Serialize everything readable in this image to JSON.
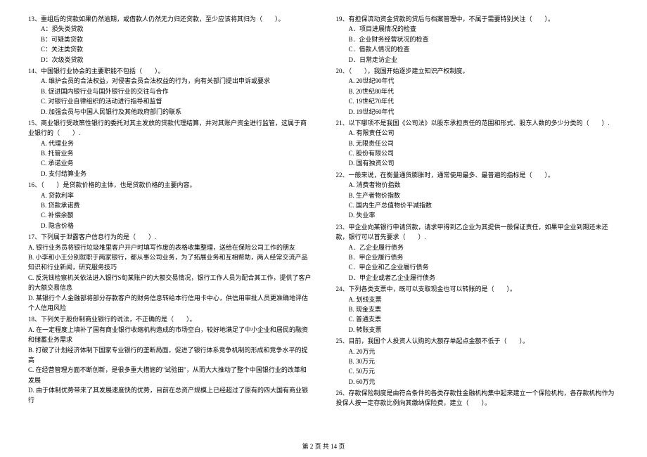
{
  "left": {
    "q13": {
      "text": "13、重组后的贷款如果仍然逾期，或借款人仍然无力归还贷款，至少应该将其归为（　　）。",
      "a": "A：损失类贷款",
      "b": "B：可疑类贷款",
      "c": "C：关注类贷款",
      "d": "D：次级类贷款"
    },
    "q14": {
      "text": "14、中国银行业协会的主要职能不包括（　　）。",
      "a": "A. 维护会员的合法权益，对侵害会员合法权益的行为，向有关部门提出申诉或要求",
      "b": "B. 促进国内银行业与国外银行业的交往与合作",
      "c": "C. 对银行业自律组织的活动进行指导和监督",
      "d": "D. 加强会员与中国人民银行及其他政府部门的联系"
    },
    "q15": {
      "text": "15、商业银行受政策性银行的委托对其主发放的贷款代理结算，并对其账户资金进行监管，这属于商业银行的（　　）.",
      "a": "A. 代理业务",
      "b": "B. 托管业务",
      "c": "C. 承诺业务",
      "d": "D. 支付结算业务"
    },
    "q16": {
      "text": "16、（　　）是贷款价格的主体，也是贷款价格的主要内容。",
      "a": "A. 贷款利率",
      "b": "B. 贷款承诺费",
      "c": "C. 补偿余额",
      "d": "D. 隐含价格"
    },
    "q17": {
      "text": "17、下列属于泄露客户信息行为的是（　　）.",
      "a": "A. 银行业务员将银行垃圾堆里客户开户时填写作废的表格收集整理，送给在保险公司工作的朋友",
      "b": "B. 小李和小王分别就职于两家银行，都从事公司业务，为了拓展业务和互相帮助，两人经常交流产品知识和行业新闻，研究服务技巧",
      "c": "C. 反洗钱检察机关依法进入银行S旬某账户的大额交易情况，银行工作人员为配合其工作，提供了客户的大额交易信息",
      "d": "D. 某银行个人金融部将部分存款客户的财务信息转给本行信用卡中心，供信用审批人员更准确地评估个人信用风险"
    },
    "q18": {
      "text": "18、下列关于股份制商业银行的说法，不正确的是（　　）。",
      "a": "A. 在一定程度上填补了国有商业银行收缩机构造成的市场空白，较好地满足了中小企业和居民的融资和储蓄业务需求",
      "b": "B. 打破了计划经济体制下国家专业银行的垄断局面，促进了银行体系竞争机制的形成和竞争水平的提高",
      "c": "C. 在经营管理方面不断创新，是很多重大措施的\"试验田\"，从而大大推动了整个中国银行业的改革和发展",
      "d": "D. 由于体制优势带来了其发展速度快的优势，目前在总资产规模上已经超过了原有的四大国有商业银行"
    }
  },
  "right": {
    "q19": {
      "text": "19、有担保流动资金贷款的贷后与档案管理中，不属于需要特别关注（　　）。",
      "a": "A．项目进展情况的检查",
      "b": "B．企业财务经营状况的检查",
      "c": "C．借款人情况的检查",
      "d": "D．日常走访企业"
    },
    "q20": {
      "text": "20、（　　），我国开始逐步建立知识产权制度。",
      "a": "A. 20世纪90年代",
      "b": "B. 20世纪80年代",
      "c": "C. 19世纪70年代",
      "d": "D. 19世纪60年代"
    },
    "q21": {
      "text": "21、以下哪项不是我国《公司法》以股东承担责任的范围和形式、股东人数的多少分类的（　　）.",
      "a": "A. 有限责任公司",
      "b": "B. 无限责任公司",
      "c": "C. 股份有限公司",
      "d": "D. 国有独资公司"
    },
    "q22": {
      "text": "22、一般来说，在衡量通货膨胀时，通常使用最多、最普遍的指标是（　　）。",
      "a": "A. 消费者物价指数",
      "b": "B. 生产者物价指数",
      "c": "C. 国内生产总值物价平减指数",
      "d": "D. 失业率"
    },
    "q23": {
      "text": "23、甲企业向某银行申请贷款，请求甲得到乙企业为其提供一般保证责任，如果甲企业到期还未还款，银行可以首先要求（　　）.",
      "a": "A．乙企业履行债务",
      "b": "B．甲企业履行债务",
      "c": "C．甲企业和乙企业履行债务",
      "d": "D．甲企业或者乙企业履行债务"
    },
    "q24": {
      "text": "24、下列各类支票中，既可以支取现金也可以转账的是（　　）。",
      "a": "A. 划线支票",
      "b": "B. 现金支票",
      "c": "C. 普通支票",
      "d": "D. 转账支票"
    },
    "q25": {
      "text": "25、目前，我国个人投资人认购的大额存单起点金额不低于（　　）。",
      "a": "A. 20万元",
      "b": "B. 30万元",
      "c": "C. 50万元",
      "d": "D. 60万元"
    },
    "q26": {
      "text": "26、存款保险制度是由符合条件的各类存款性金融机构集中起来建立一个保险机构，各存款机构作为投保人按一定存款比例向其缴纳保险费，建立（　　）。"
    }
  },
  "footer": "第 2 页 共 14 页"
}
